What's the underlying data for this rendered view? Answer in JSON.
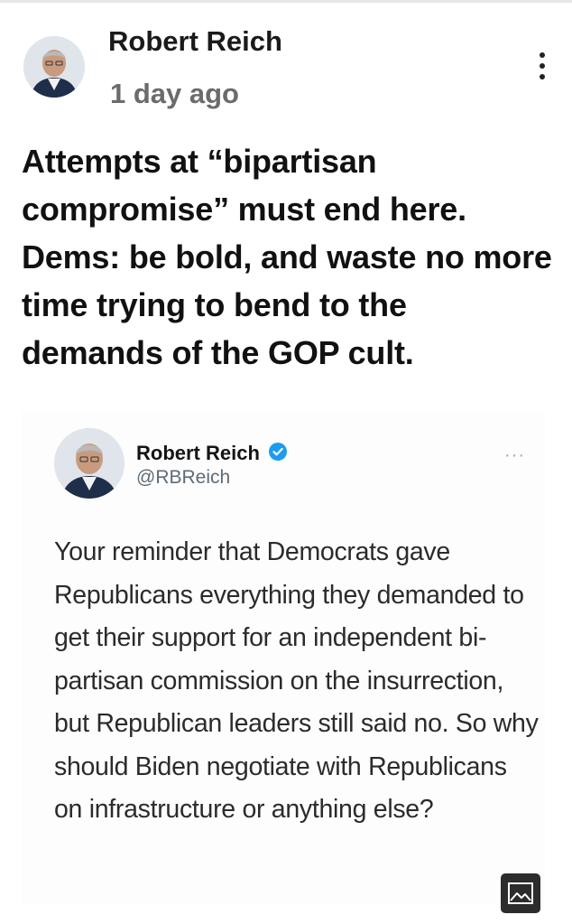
{
  "post": {
    "author": "Robert Reich",
    "time": "1 day ago",
    "text": "Attempts at “bipartisan compromise” must end here. Dems: be bold, and waste no more time trying to bend to the demands of the GOP cult."
  },
  "tweet": {
    "name": "Robert Reich",
    "handle": "@RBReich",
    "more": "···",
    "text": "Your reminder that Democrats gave Republicans everything they demanded to get their support for an independent bi-partisan commission on the insurrection, but Republican leaders still said no.  So why should Biden negotiate with Republicans on infrastructure or anything else?"
  },
  "icons": {
    "menu": "more-vertical-icon",
    "verified": "verified-badge-icon",
    "image": "image-icon"
  },
  "colors": {
    "verified_blue": "#1d9bf0",
    "timestamp_gray": "#6b6b6b"
  }
}
